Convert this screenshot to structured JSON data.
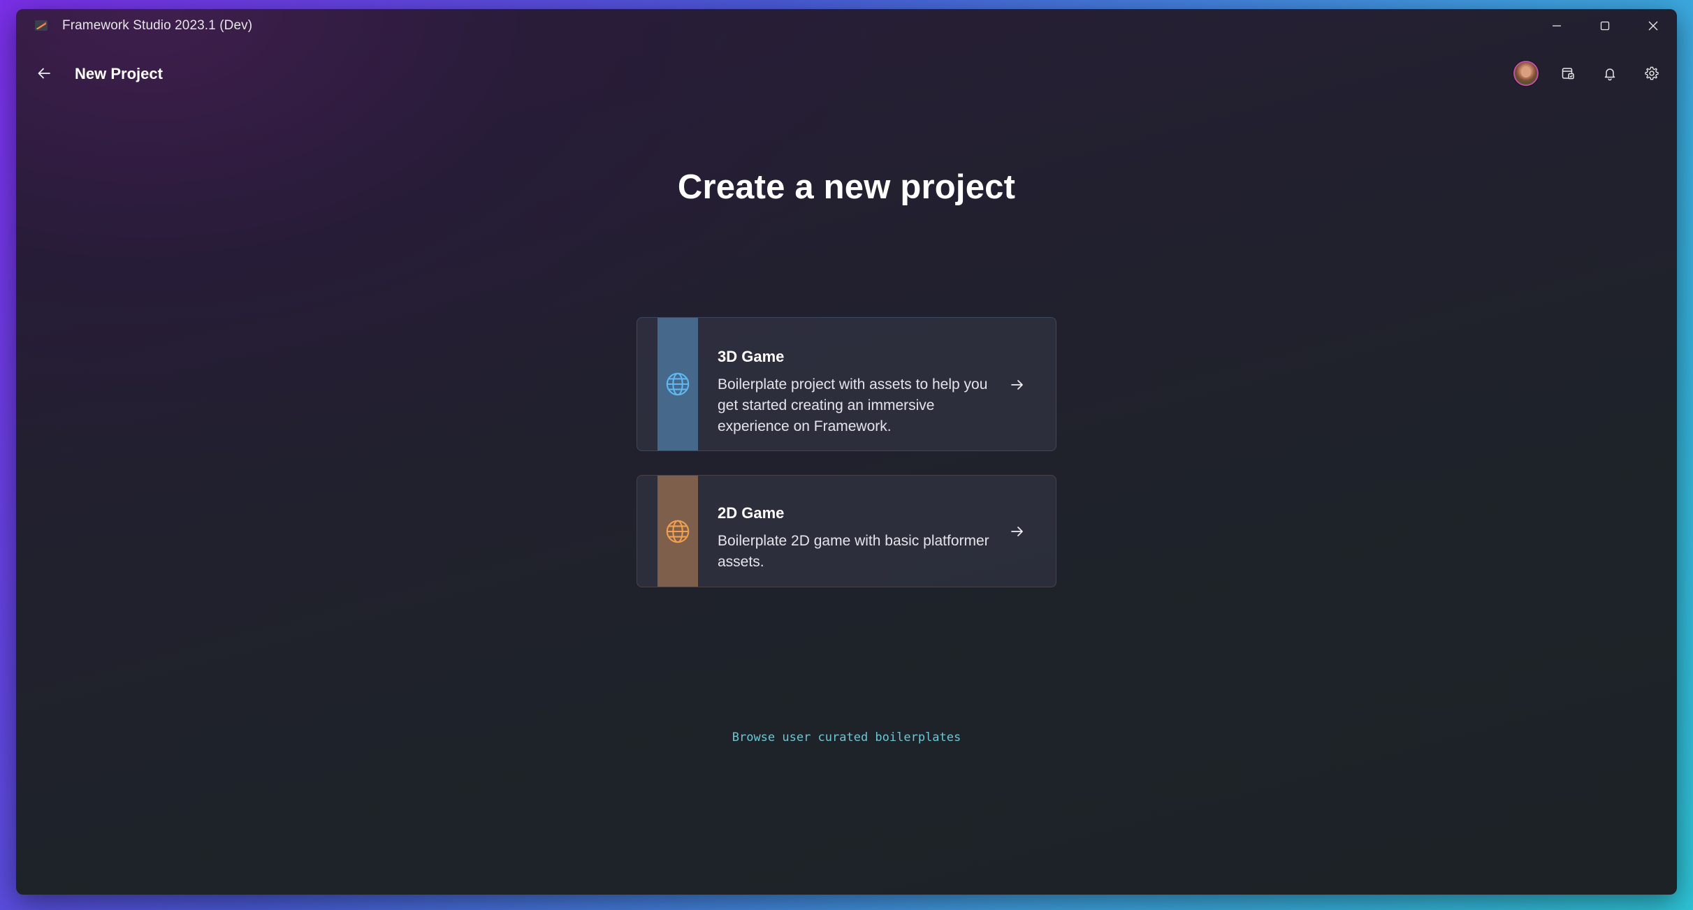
{
  "window": {
    "title": "Framework Studio 2023.1 (Dev)",
    "app_icon": "app-logo-icon",
    "controls": {
      "minimize_icon": "minimize-icon",
      "maximize_icon": "maximize-icon",
      "close_icon": "close-icon"
    }
  },
  "header": {
    "back_icon": "back-arrow-icon",
    "title": "New Project",
    "actions": [
      "avatar",
      "project-switch-icon",
      "bell-icon",
      "gear-icon"
    ]
  },
  "main": {
    "heading": "Create a new project",
    "templates": [
      {
        "title": "3D Game",
        "description": "Boilerplate project with assets to help you get started creating an immersive experience on Framework.",
        "icon": "globe-icon",
        "accent": "#46698b",
        "icon_color": "#5fb8f0"
      },
      {
        "title": "2D Game",
        "description": "Boilerplate 2D game with basic platformer assets.",
        "icon": "globe-icon",
        "accent": "#7e5f4c",
        "icon_color": "#f0a04e"
      }
    ],
    "browse_link": "Browse user curated boilerplates"
  },
  "colors": {
    "link": "#6fc6d4",
    "window_bg": "#1d2328"
  }
}
